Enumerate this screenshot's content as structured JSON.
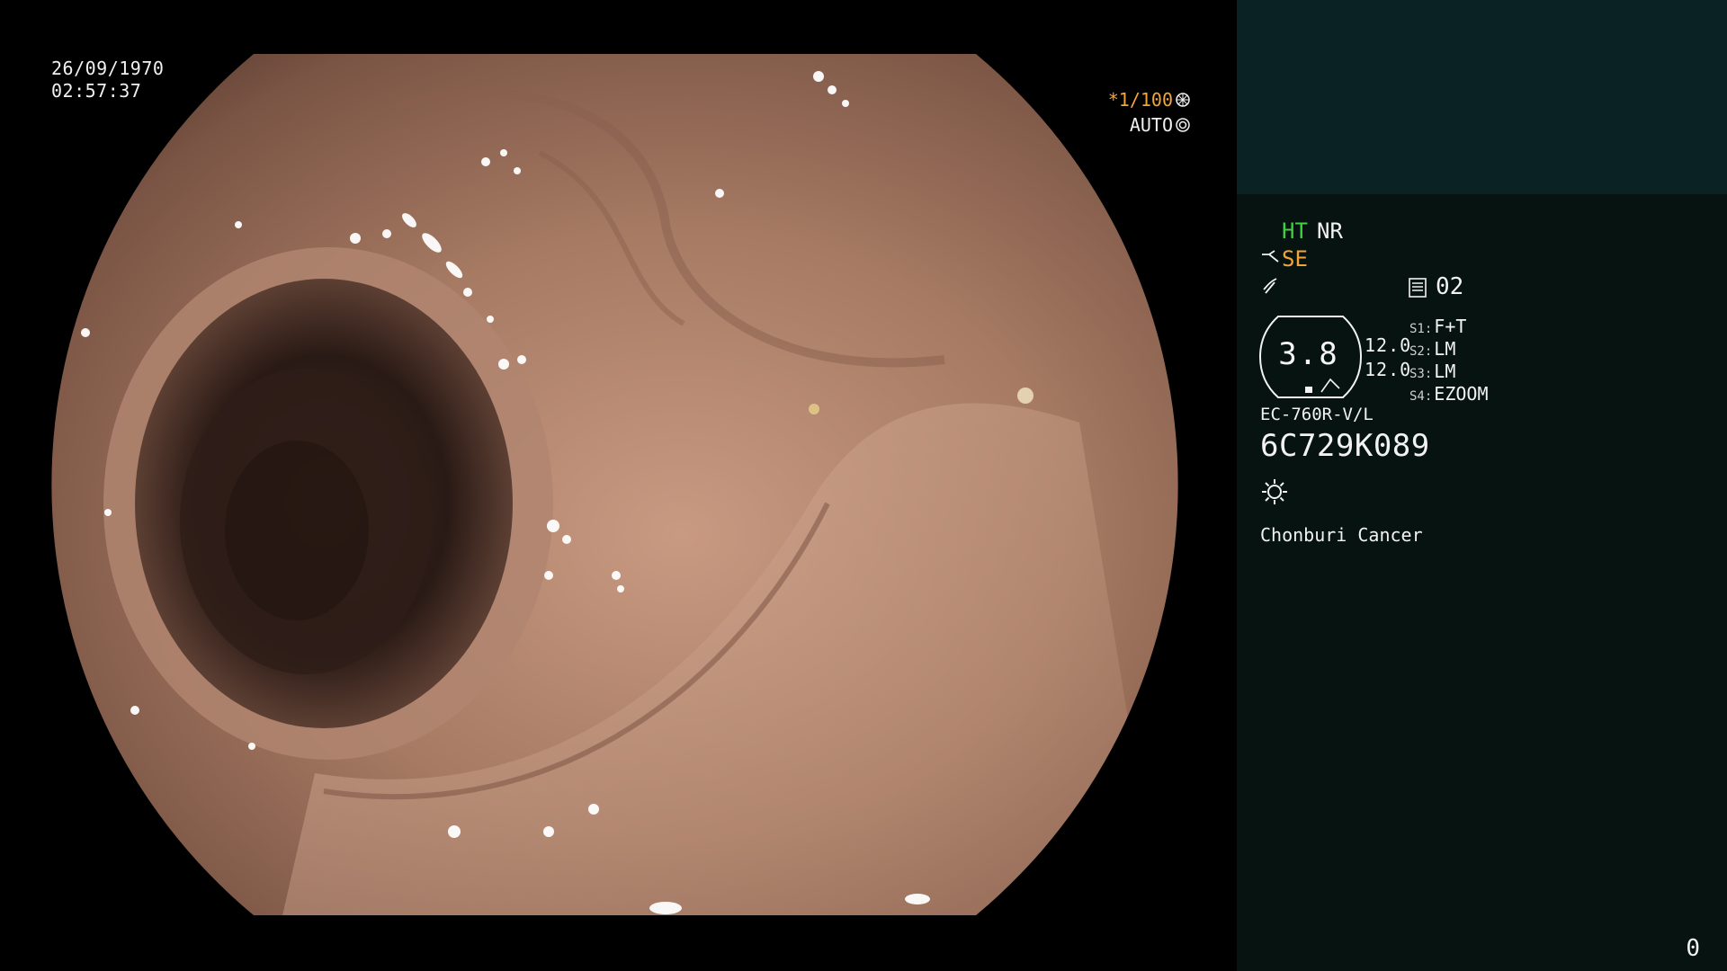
{
  "overlay": {
    "date": "26/09/1970",
    "time": "02:57:37",
    "shutter": "*1/100",
    "iris": "AUTO"
  },
  "panel": {
    "ht": "HT",
    "nr": "NR",
    "se": "SE",
    "memory": "02",
    "gauge_value": "3.8",
    "gauge_values": [
      "12.0",
      "12.0"
    ],
    "switches": [
      {
        "key": "S1:",
        "value": "F+T"
      },
      {
        "key": "S2:",
        "value": "LM"
      },
      {
        "key": "S3:",
        "value": "LM"
      },
      {
        "key": "S4:",
        "value": "EZOOM"
      }
    ],
    "scope_model": "EC-760R-V/L",
    "scope_serial": "6C729K089",
    "institution": "Chonburi Cancer",
    "counter": "0"
  },
  "colors": {
    "accent_orange": "#f0a43a",
    "accent_green": "#40d040",
    "panel_bg": "#061311",
    "panel_top_bg": "#0b2224"
  },
  "icons": {
    "shutter": "shutter-icon",
    "iris": "iris-icon",
    "structure": "structure-enhance-icon",
    "color": "color-enhance-icon",
    "memory": "memory-card-icon",
    "light": "light-source-icon"
  }
}
